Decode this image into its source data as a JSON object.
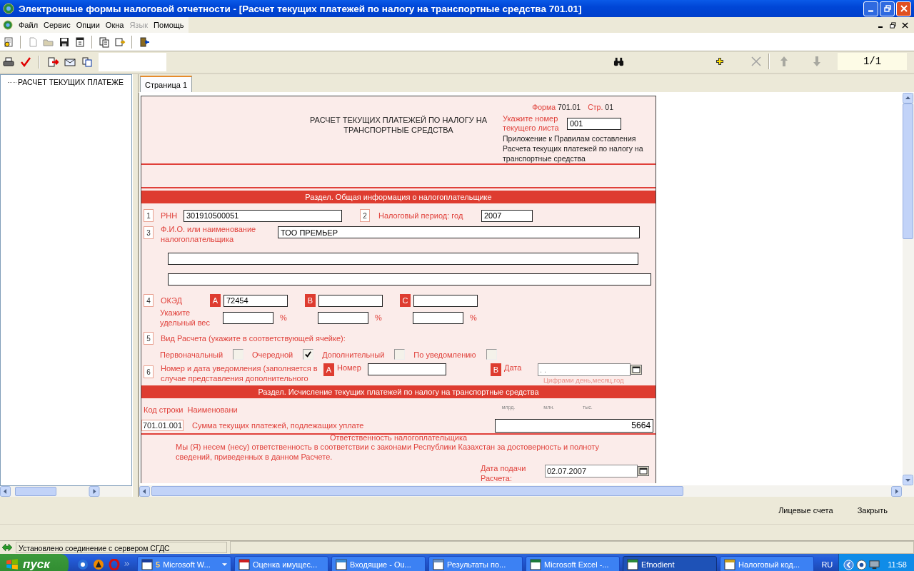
{
  "window": {
    "title": "Электронные формы налоговой отчетности - [Расчет текущих платежей по налогу на транспортные средства 701.01]"
  },
  "menu": [
    {
      "label": "Файл",
      "disabled": false
    },
    {
      "label": "Сервис",
      "disabled": false
    },
    {
      "label": "Опции",
      "disabled": false
    },
    {
      "label": "Окна",
      "disabled": false
    },
    {
      "label": "Язык",
      "disabled": true
    },
    {
      "label": "Помощь",
      "disabled": false
    }
  ],
  "toolbar": {
    "page_counter": "1/1"
  },
  "tree": {
    "items": [
      {
        "label": "РАСЧЕТ ТЕКУЩИХ ПЛАТЕЖЕ"
      }
    ]
  },
  "tabs": [
    {
      "label": "Страница 1",
      "selected": true
    }
  ],
  "form": {
    "header": {
      "form_label": "Форма",
      "form_number": "701.01",
      "page_label": "Стр.",
      "page_number": "01",
      "title": "РАСЧЕТ ТЕКУЩИХ ПЛАТЕЖЕЙ ПО НАЛОГУ НА ТРАНСПОРТНЫЕ СРЕДСТВА",
      "sheet_label": "Укажите номер текущего листа",
      "sheet_value": "001",
      "appendix": "Приложение к Правилам составления Расчета текущих платежей по налогу на транспортные средства"
    },
    "section_1": {
      "title": "Раздел. Общая информация о налогоплательщике",
      "rnn": {
        "number": "1",
        "label": "РНН",
        "value": "301910500051"
      },
      "period": {
        "number": "2",
        "label": "Налоговый период: год",
        "value": "2007"
      },
      "name": {
        "number": "3",
        "label": "Ф.И.О. или наименование налогоплательщика",
        "lines": [
          "ТОО ПРЕМЬЕР"
        ]
      },
      "oked": {
        "number": "4",
        "label": "ОКЭД",
        "weight_label": "Укажите удельный вес",
        "codes": [
          {
            "letter": "A",
            "value": "72454",
            "percent": "%"
          },
          {
            "letter": "B",
            "percent": "%"
          },
          {
            "letter": "C",
            "percent": "%"
          }
        ]
      },
      "calc_type": {
        "number": "5",
        "label": "Вид Расчета (укажите в соответствующей ячейке):",
        "options": [
          {
            "label": "Первоначальный",
            "checked": false
          },
          {
            "label": "Очередной",
            "checked": true
          },
          {
            "label": "Дополнительный",
            "checked": false
          },
          {
            "label": "По уведомлению",
            "checked": false
          }
        ]
      },
      "notice": {
        "number": "6",
        "label": "Номер и дата уведомления (заполняется в случае представления дополнительного",
        "number_letter": "A",
        "number_label": "Номер",
        "date_letter": "B",
        "date_label": "Дата",
        "date_placeholder": ". .",
        "date_hint": "Цифрами день,месяц,год"
      }
    },
    "section_2": {
      "title": "Раздел. Исчисление текущих платежей по налогу на транспортные средства",
      "code_header": "Код строки",
      "name_header": "Наименовани",
      "units": [
        "млрд.",
        "млн.",
        "тыс."
      ],
      "rows": [
        {
          "code": "701.01.001",
          "name": "Сумма текущих платежей, подлежащих уплате",
          "value": "5664"
        }
      ]
    },
    "responsibility": {
      "title": "Ответственность налогоплательщика",
      "text": "Мы (Я) несем (несу) ответственность в соответствии с законами Республики Казахстан за достоверность и полноту сведений, приведенных в данном Расчете.",
      "date_label": "Дата подачи Расчета:",
      "date_value": "02.07.2007"
    }
  },
  "actions": [
    "Лицевые счета",
    "Закрыть"
  ],
  "status_bar": {
    "text": "Установлено соединение с сервером СГДС"
  },
  "taskbar": {
    "start": "пуск",
    "tasks": [
      {
        "label": "Microsoft W...",
        "count": "5",
        "group": true,
        "selected": false
      },
      {
        "label": "Оценка имущес...",
        "selected": false
      },
      {
        "label": "Входящие - Ou...",
        "selected": false
      },
      {
        "label": "Результаты по...",
        "selected": false
      },
      {
        "label": "Microsoft Excel -...",
        "selected": false
      },
      {
        "label": "Efnodient",
        "selected": true
      },
      {
        "label": "Налоговый код...",
        "selected": false
      }
    ],
    "language": "RU",
    "clock": "11:58"
  }
}
